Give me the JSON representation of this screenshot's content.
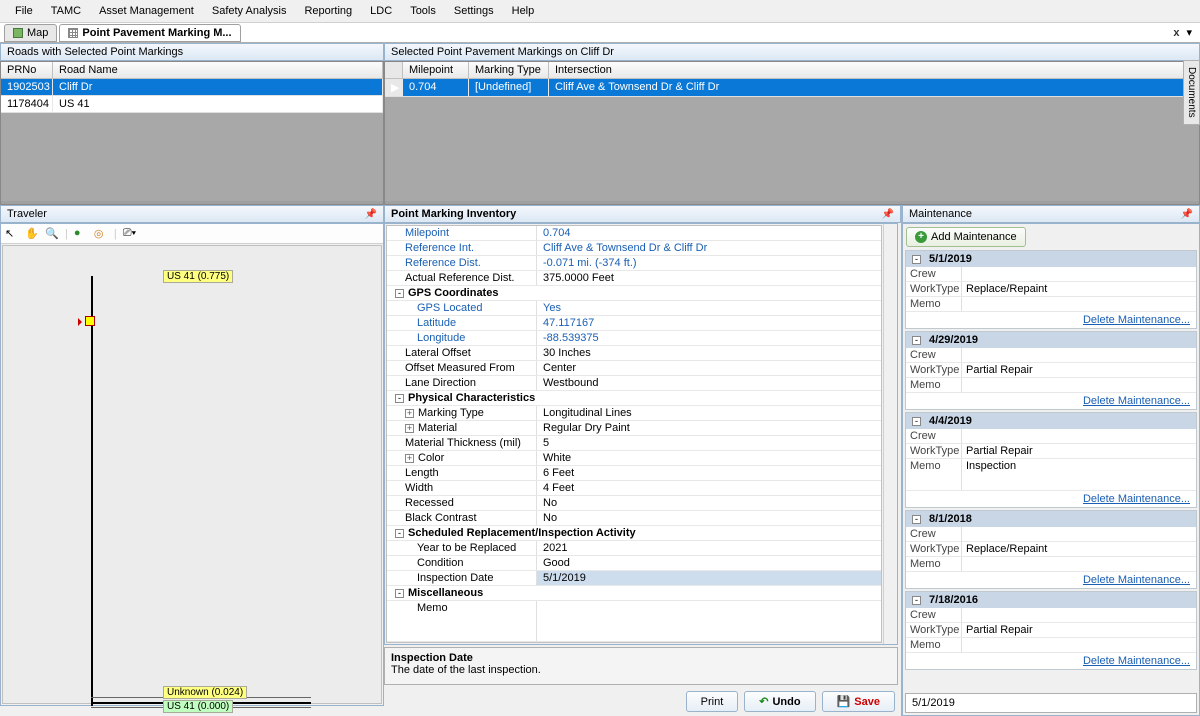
{
  "menu": [
    "File",
    "TAMC",
    "Asset Management",
    "Safety Analysis",
    "Reporting",
    "LDC",
    "Tools",
    "Settings",
    "Help"
  ],
  "tabs": {
    "map": "Map",
    "marking": "Point Pavement Marking M...",
    "close_x": "x",
    "dropdown_x": "▾"
  },
  "roads_panel": {
    "title": "Roads with Selected Point Markings",
    "cols": [
      "PRNo",
      "Road Name"
    ],
    "rows": [
      {
        "prno": "1902503",
        "name": "Cliff Dr",
        "sel": true
      },
      {
        "prno": "1178404",
        "name": "US 41",
        "sel": false
      }
    ]
  },
  "markings_panel": {
    "title": "Selected Point Pavement Markings on Cliff Dr",
    "cols": [
      "",
      "Milepoint",
      "Marking Type",
      "Intersection"
    ],
    "rows": [
      {
        "mp": "0.704",
        "mt": "[Undefined]",
        "int": "Cliff Ave & Townsend Dr & Cliff Dr",
        "sel": true
      }
    ]
  },
  "traveler": {
    "title": "Traveler",
    "labels": {
      "top": "US 41 (0.775)",
      "mid": "Unknown (0.024)",
      "bot": "US 41 (0.000)"
    }
  },
  "inventory": {
    "title": "Point Marking Inventory",
    "rows": [
      {
        "type": "kv",
        "cls": "blue",
        "label": "Milepoint",
        "value": "0.704"
      },
      {
        "type": "kv",
        "cls": "blue",
        "label": "Reference Int.",
        "value": "Cliff Ave & Townsend Dr & Cliff Dr"
      },
      {
        "type": "kv",
        "cls": "blue",
        "label": "Reference Dist.",
        "value": "-0.071 mi. (-374 ft.)"
      },
      {
        "type": "kv",
        "label": "Actual Reference Dist.",
        "value": "375.0000 Feet"
      },
      {
        "type": "cat",
        "label": "GPS Coordinates",
        "exp": "-"
      },
      {
        "type": "kv",
        "cls": "blue sub",
        "label": "GPS Located",
        "value": "Yes"
      },
      {
        "type": "kv",
        "cls": "blue sub",
        "label": "Latitude",
        "value": "47.117167"
      },
      {
        "type": "kv",
        "cls": "blue sub",
        "label": "Longitude",
        "value": "-88.539375"
      },
      {
        "type": "kv",
        "label": "Lateral Offset",
        "value": "30 Inches"
      },
      {
        "type": "kv",
        "label": "Offset Measured From",
        "value": "Center"
      },
      {
        "type": "kv",
        "label": "Lane Direction",
        "value": "Westbound"
      },
      {
        "type": "cat",
        "label": "Physical Characteristics",
        "exp": "-"
      },
      {
        "type": "kv",
        "label": "Marking Type",
        "value": "Longitudinal Lines",
        "box": "+"
      },
      {
        "type": "kv",
        "label": "Material",
        "value": "Regular Dry Paint",
        "box": "+"
      },
      {
        "type": "kv",
        "label": "Material Thickness (mil)",
        "value": "5"
      },
      {
        "type": "kv",
        "label": "Color",
        "value": "White",
        "box": "+"
      },
      {
        "type": "kv",
        "label": "Length",
        "value": "6 Feet"
      },
      {
        "type": "kv",
        "label": "Width",
        "value": "4 Feet"
      },
      {
        "type": "kv",
        "label": "Recessed",
        "value": "No"
      },
      {
        "type": "kv",
        "label": "Black Contrast",
        "value": "No"
      },
      {
        "type": "cat",
        "label": "Scheduled Replacement/Inspection Activity",
        "exp": "-"
      },
      {
        "type": "kv",
        "sub": true,
        "label": "Year to be Replaced",
        "value": "2021"
      },
      {
        "type": "kv",
        "sub": true,
        "label": "Condition",
        "value": "Good"
      },
      {
        "type": "kv",
        "sub": true,
        "cls": "highlight",
        "label": "Inspection Date",
        "value": "5/1/2019"
      },
      {
        "type": "cat",
        "label": "Miscellaneous",
        "exp": "-"
      },
      {
        "type": "kv",
        "sub": true,
        "label": "Memo",
        "value": "",
        "tall": true
      }
    ],
    "desc": {
      "title": "Inspection Date",
      "text": "The date of the last inspection."
    },
    "buttons": {
      "print": "Print",
      "undo": "Undo",
      "save": "Save"
    }
  },
  "maint": {
    "title": "Maintenance",
    "add": "Add Maintenance",
    "del": "Delete Maintenance...",
    "labels": {
      "crew": "Crew",
      "worktype": "WorkType",
      "memo": "Memo"
    },
    "items": [
      {
        "date": "5/1/2019",
        "crew": "",
        "worktype": "Replace/Repaint",
        "memo": ""
      },
      {
        "date": "4/29/2019",
        "crew": "",
        "worktype": "Partial Repair",
        "memo": ""
      },
      {
        "date": "4/4/2019",
        "crew": "",
        "worktype": "Partial Repair",
        "memo": "Inspection",
        "tall": true
      },
      {
        "date": "8/1/2018",
        "crew": "",
        "worktype": "Replace/Repaint",
        "memo": ""
      },
      {
        "date": "7/18/2016",
        "crew": "",
        "worktype": "Partial Repair",
        "memo": ""
      }
    ],
    "footer": "5/1/2019"
  },
  "side_tab": "Documents"
}
